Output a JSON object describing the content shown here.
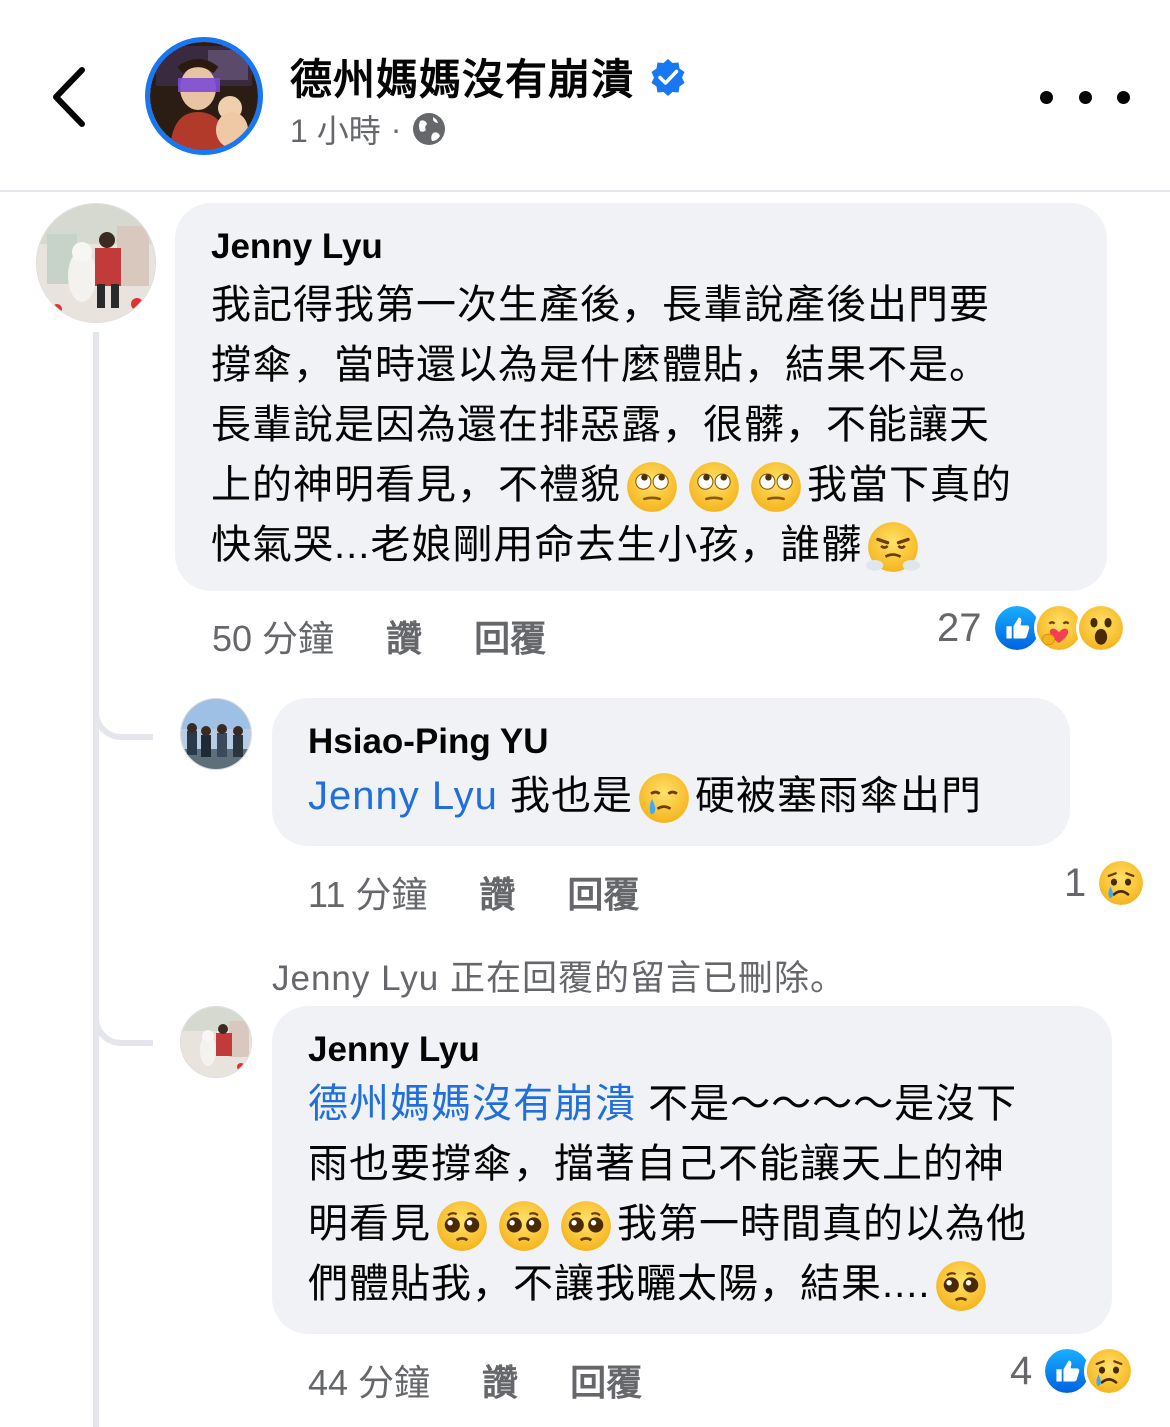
{
  "header": {
    "page_name": "德州媽媽沒有崩潰",
    "time": "1 小時",
    "separator": "·"
  },
  "comments": [
    {
      "author": "Jenny Lyu",
      "lines": [
        "我記得我第一次生產後，長輩說產後出門要",
        "撐傘，當時還以為是什麼體貼，結果不是。",
        "長輩說是因為還在排惡露，很髒，不能讓天",
        "上的神明看見，不禮貌",
        "我當下真的",
        "快氣哭...老娘剛用命去生小孩，誰髒"
      ],
      "time": "50 分鐘",
      "like_label": "讚",
      "reply_label": "回覆",
      "reaction_count": "27"
    },
    {
      "author": "Hsiao-Ping  YU",
      "mention": "Jenny Lyu",
      "text_a": "我也是",
      "text_b": "硬被塞雨傘出門",
      "time": "11 分鐘",
      "like_label": "讚",
      "reply_label": "回覆",
      "reaction_count": "1"
    },
    {
      "deleted_note": "Jenny Lyu 正在回覆的留言已刪除。",
      "author": "Jenny Lyu",
      "mention": "德州媽媽沒有崩潰",
      "lines": [
        "不是～～～～是沒下",
        "雨也要撐傘，擋著自己不能讓天上的神",
        "明看見",
        "我第一時間真的以為他",
        "們體貼我，不讓我曬太陽，結果...."
      ],
      "time": "44 分鐘",
      "like_label": "讚",
      "reply_label": "回覆",
      "reaction_count": "4"
    }
  ],
  "colors": {
    "accent": "#1877f2",
    "mention": "#216fdb",
    "bubble": "#f0f2f5",
    "secondary_text": "#65676b"
  },
  "icons": [
    "back-chevron-icon",
    "verified-badge-icon",
    "globe-icon",
    "more-dots-icon",
    "eye-roll-emoji",
    "huffing-emoji",
    "crying-emoji",
    "pleading-emoji",
    "like-reaction-icon",
    "care-reaction-icon",
    "wow-reaction-icon",
    "sad-reaction-icon"
  ]
}
